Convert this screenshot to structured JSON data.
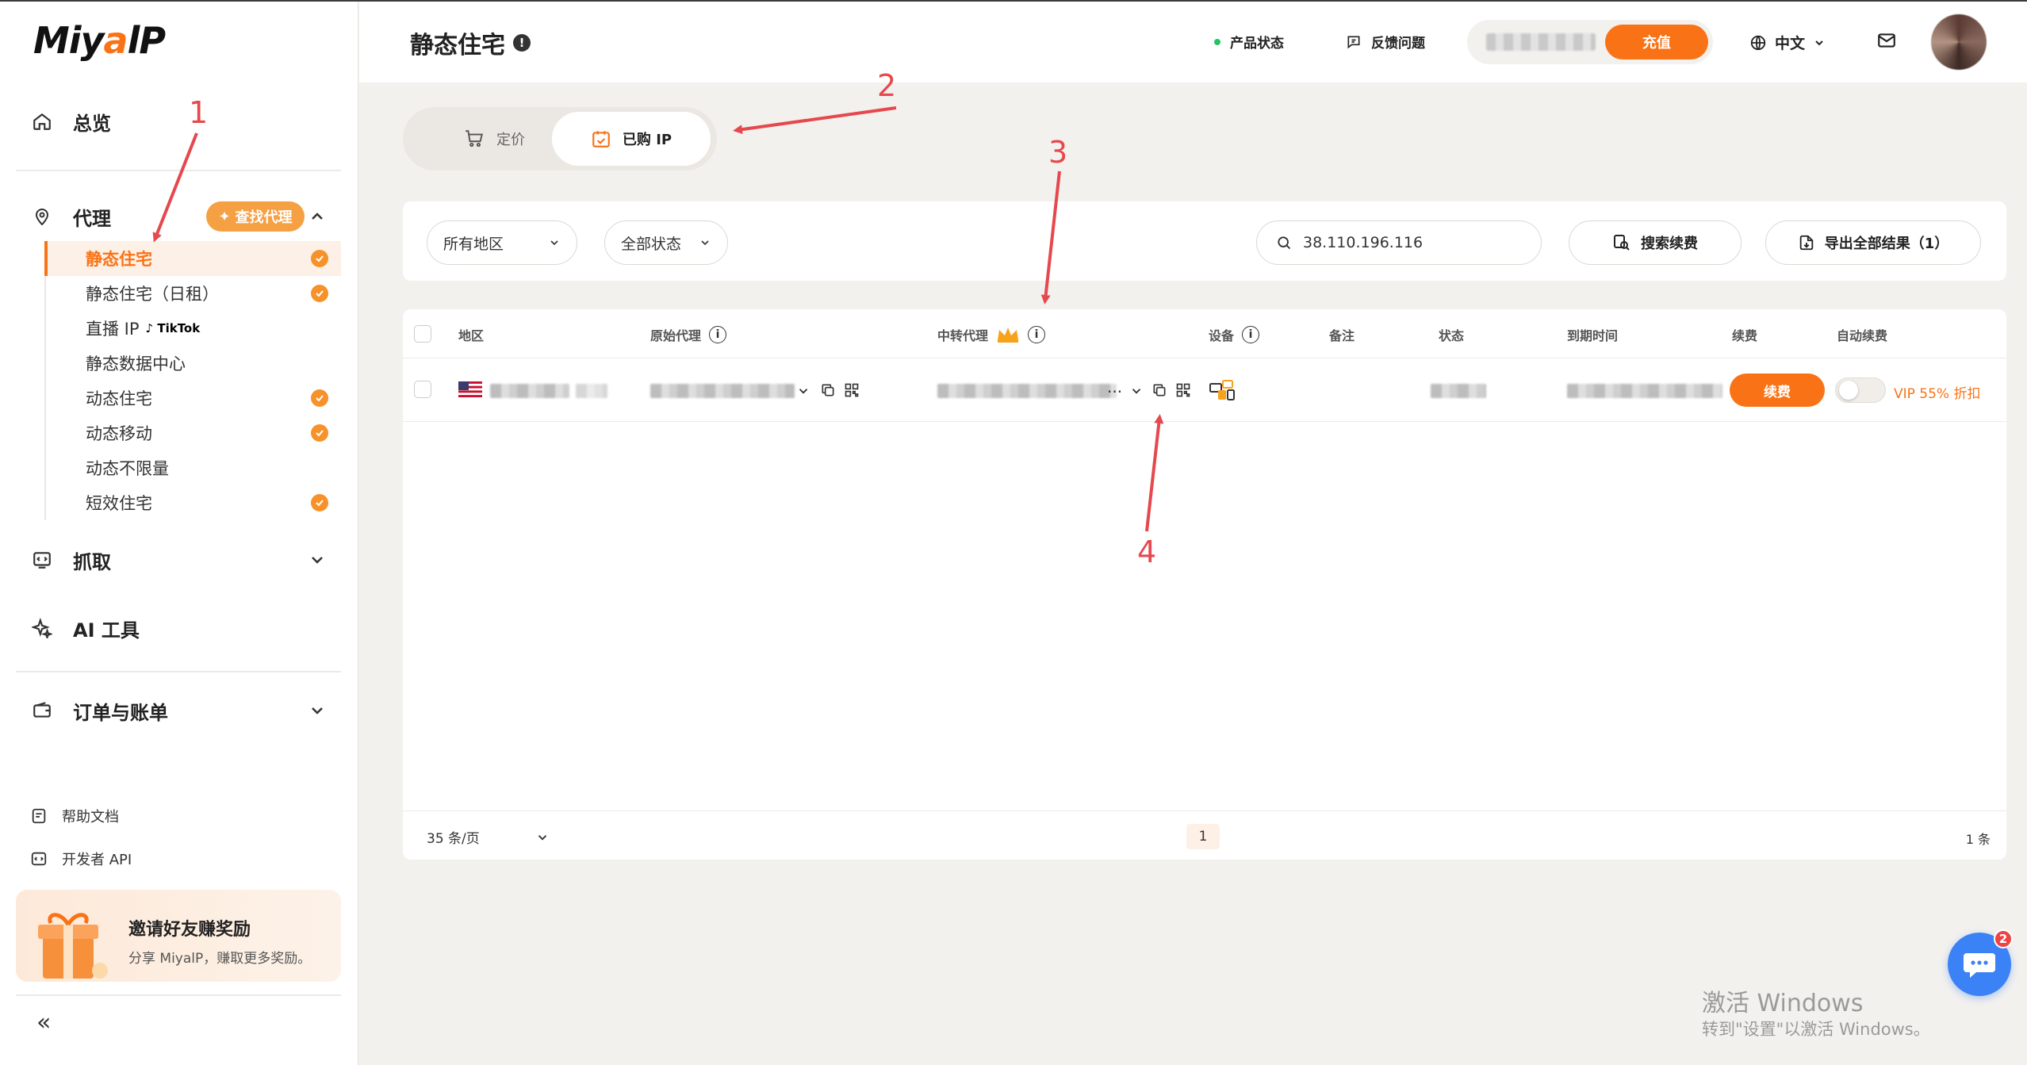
{
  "brand": {
    "logo_text_a": "Miy",
    "logo_text_b": "a",
    "logo_text_c": "lP"
  },
  "sidebar": {
    "overview": "总览",
    "proxy": "代理",
    "find_proxy": "查找代理",
    "sub_items": [
      {
        "label": "静态住宅",
        "checked": true,
        "active": true
      },
      {
        "label": "静态住宅（日租）",
        "checked": true
      },
      {
        "label": "直播 IP",
        "tag": "TikTok",
        "checked": false
      },
      {
        "label": "静态数据中心",
        "checked": false
      },
      {
        "label": "动态住宅",
        "checked": true
      },
      {
        "label": "动态移动",
        "checked": true
      },
      {
        "label": "动态不限量",
        "checked": false
      },
      {
        "label": "短效住宅",
        "checked": true
      }
    ],
    "scrape": "抓取",
    "ai_tools": "AI 工具",
    "orders": "订单与账单",
    "help_docs": "帮助文档",
    "dev_api": "开发者 API",
    "invite_title": "邀请好友赚奖励",
    "invite_sub": "分享 MiyalP，赚取更多奖励。",
    "collapse": "«"
  },
  "header": {
    "title": "静态住宅",
    "product_status": "产品状态",
    "feedback": "反馈问题",
    "recharge": "充值",
    "language": "中文"
  },
  "tabs": {
    "pricing": "定价",
    "bought": "已购 IP"
  },
  "filters": {
    "region": "所有地区",
    "status": "全部状态",
    "search_value": "38.110.196.116",
    "search_renew": "搜索续费",
    "export": "导出全部结果（1）"
  },
  "table": {
    "columns": [
      "地区",
      "原始代理",
      "中转代理",
      "设备",
      "备注",
      "状态",
      "到期时间",
      "续费",
      "自动续费"
    ],
    "row": {
      "relay_suffix": "...",
      "renew": "续费",
      "vip": "VIP 55% 折扣"
    }
  },
  "pagination": {
    "page_size": "35 条/页",
    "current_page": "1",
    "total": "1 条"
  },
  "annotations": [
    "1",
    "2",
    "3",
    "4"
  ],
  "chat_badge": "2",
  "watermark": {
    "line1": "激活 Windows",
    "line2": "转到\"设置\"以激活 Windows。"
  },
  "colors": {
    "accent": "#f97316",
    "annotation": "#e5484d",
    "chat": "#3b82f6"
  }
}
